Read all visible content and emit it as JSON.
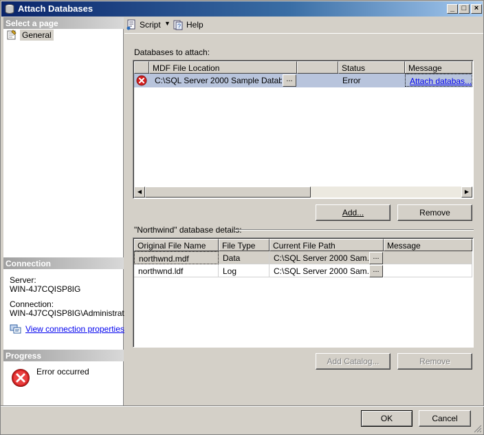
{
  "window": {
    "title": "Attach Databases"
  },
  "left_pane": {
    "select_page_header": "Select a page",
    "pages": [
      {
        "label": "General",
        "icon": "page-icon"
      }
    ],
    "connection_header": "Connection",
    "server_label": "Server:",
    "server_value": "WIN-4J7CQISP8IG",
    "connection_label": "Connection:",
    "connection_value": "WIN-4J7CQISP8IG\\Administrator",
    "view_connection_link": "View connection properties",
    "progress_header": "Progress",
    "progress_status": "Error occurred"
  },
  "toolbar": {
    "script_label": "Script",
    "help_label": "Help"
  },
  "attach": {
    "section_label": "Databases to attach:",
    "columns": [
      "MDF File Location",
      "",
      "Status",
      "Message"
    ],
    "rows": [
      {
        "status_icon": "error-icon",
        "mdf_location": "C:\\SQL Server 2000 Sample Datab...",
        "status": "Error",
        "message": "Attach databas..."
      }
    ],
    "add_label": "Add...",
    "remove_label": "Remove"
  },
  "details": {
    "section_label": "\"Northwind\" database details:",
    "columns": [
      "Original File Name",
      "File Type",
      "Current File Path",
      "Message"
    ],
    "rows": [
      {
        "name": "northwnd.mdf",
        "type": "Data",
        "path": "C:\\SQL Server 2000 Sam...",
        "message": ""
      },
      {
        "name": "northwnd.ldf",
        "type": "Log",
        "path": "C:\\SQL Server 2000 Sam...",
        "message": ""
      }
    ],
    "add_catalog_label": "Add Catalog...",
    "remove_label": "Remove"
  },
  "footer": {
    "ok_label": "OK",
    "cancel_label": "Cancel"
  },
  "colors": {
    "title_start": "#0a246a",
    "error_red": "#d40000",
    "selected_row": "#b8c4dc",
    "link": "#0000ee"
  }
}
